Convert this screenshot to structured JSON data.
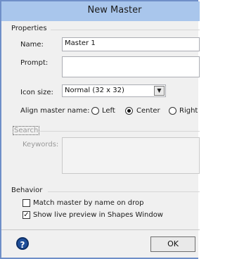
{
  "window": {
    "title": "New Master"
  },
  "properties": {
    "header": "Properties",
    "name_label": "Name:",
    "name_value": "Master 1",
    "prompt_label": "Prompt:",
    "prompt_value": "",
    "icon_size_label": "Icon size:",
    "icon_size_value": "Normal (32 x 32)",
    "align_label": "Align master name:",
    "align_options": [
      "Left",
      "Center",
      "Right"
    ],
    "align_selected": "Center"
  },
  "search": {
    "header": "Search",
    "keywords_label": "Keywords:",
    "keywords_value": ""
  },
  "behavior": {
    "header": "Behavior",
    "match_label": "Match master by name on drop",
    "match_checked": false,
    "preview_label": "Show live preview in Shapes Window",
    "preview_checked": true
  },
  "footer": {
    "ok_label": "OK",
    "help_glyph": "?"
  },
  "icons": {
    "dropdown": "chevron-down-icon",
    "help": "help-icon",
    "check": "checkmark-icon"
  }
}
